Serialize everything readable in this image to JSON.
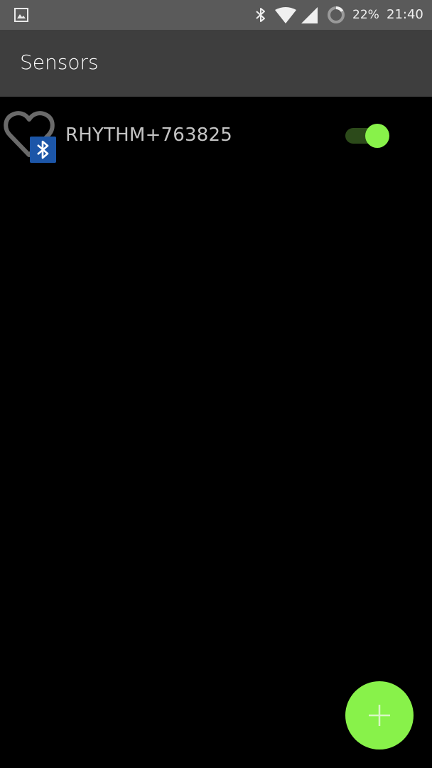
{
  "status_bar": {
    "battery_percent": "22%",
    "time": "21:40",
    "icons": [
      "gallery-icon",
      "bluetooth-icon",
      "wifi-icon",
      "signal-icon",
      "battery-ring-icon"
    ]
  },
  "app_bar": {
    "title": "Sensors"
  },
  "sensors": [
    {
      "name": "RHYTHM+763825",
      "icon": "heart-icon",
      "badge": "bluetooth-icon",
      "enabled": true
    }
  ],
  "fab": {
    "icon": "plus-icon"
  },
  "colors": {
    "status_bar_bg": "#5a5a5a",
    "app_bar_bg": "#3e3e3e",
    "background": "#000000",
    "accent_green": "#88f24a",
    "toggle_track": "#2c4a1a",
    "bluetooth_badge": "#1c56a8",
    "sensor_text": "#c4c4c4"
  }
}
